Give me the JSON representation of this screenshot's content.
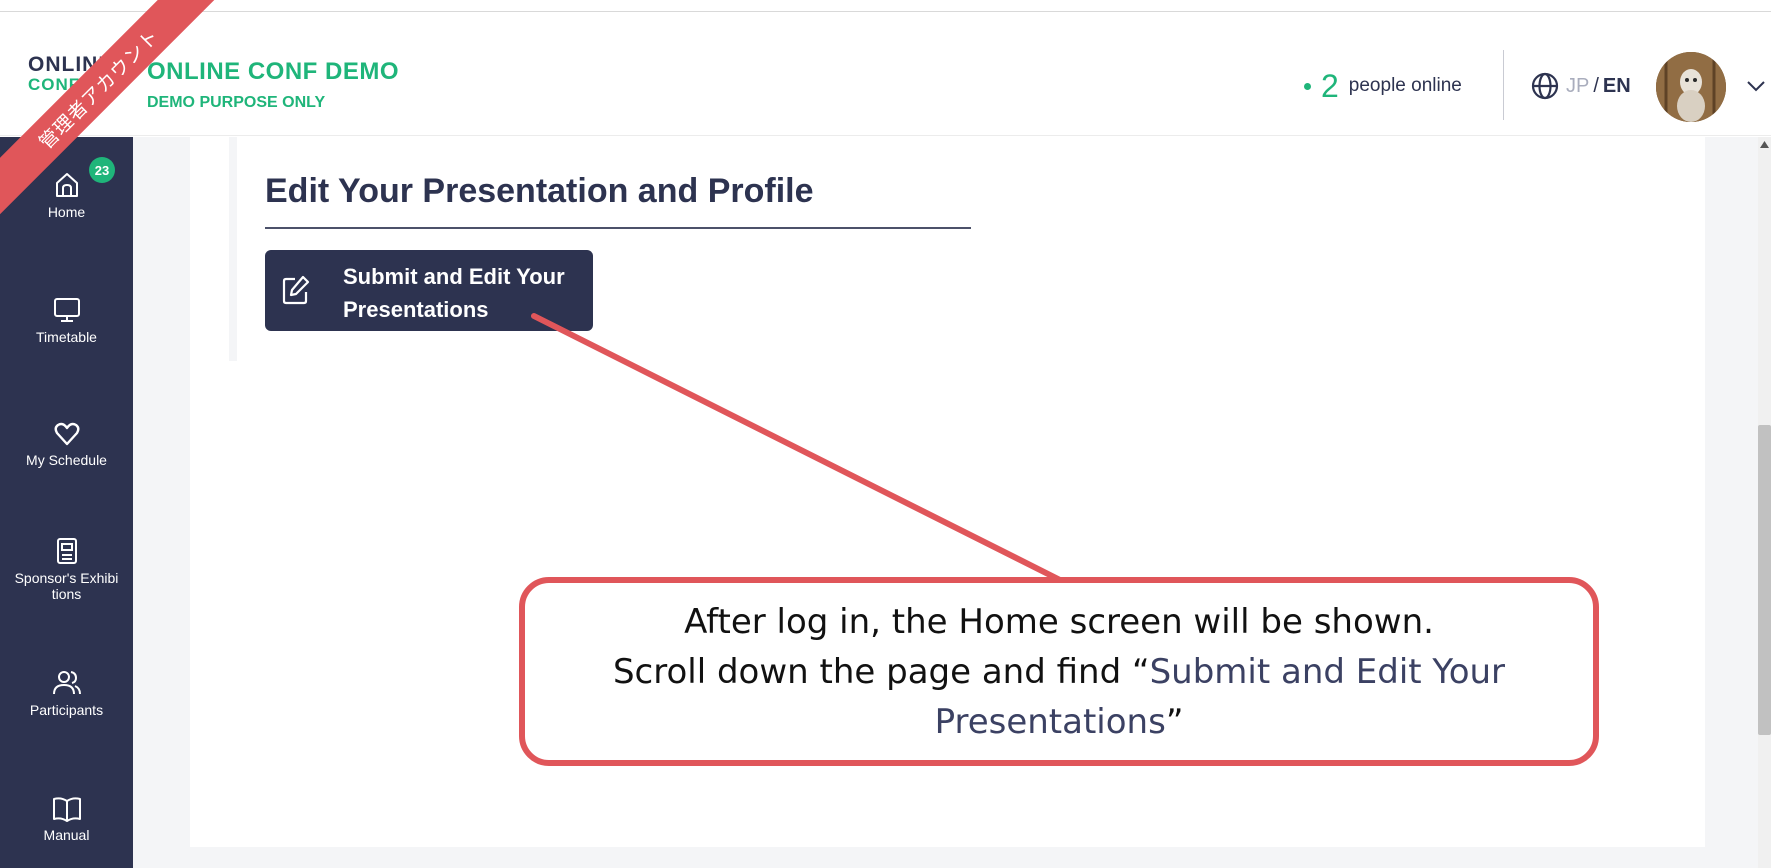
{
  "header": {
    "logo_line1": "ONLINE",
    "logo_line2": "CONF",
    "app_title": "ONLINE CONF DEMO",
    "app_subtitle": "DEMO PURPOSE ONLY",
    "online_count": "2",
    "online_label": "people online",
    "lang_jp": "JP",
    "lang_separator": "/",
    "lang_en": "EN",
    "globe_icon": "globe-icon",
    "dropdown_icon": "chevron-down-icon"
  },
  "ribbon": {
    "text": "管理者アカウント"
  },
  "sidebar": {
    "home_badge": "23",
    "items": [
      {
        "label": "Home",
        "icon": "home-icon"
      },
      {
        "label": "Timetable",
        "icon": "monitor-icon"
      },
      {
        "label": "My Schedule",
        "icon": "heart-icon"
      },
      {
        "label": "Sponsor's Exhibitions",
        "label_line1": "Sponsor's Exhibi",
        "label_line2": "tions",
        "icon": "booth-icon"
      },
      {
        "label": "Participants",
        "icon": "people-icon"
      },
      {
        "label": "Manual",
        "icon": "book-icon"
      }
    ]
  },
  "main": {
    "section_title": "Edit Your Presentation and Profile",
    "submit_button": {
      "line1": "Submit and Edit Your",
      "line2": "Presentations",
      "icon": "edit-icon"
    }
  },
  "annotation": {
    "line1": "After log in, the Home screen will be shown.",
    "line2_prefix": "Scroll down the page and find “",
    "line2_highlight": "Submit and Edit Your",
    "line3_highlight": "Presentations",
    "line3_suffix": "”"
  },
  "colors": {
    "brand_green": "#1fb57a",
    "navy": "#2d3350",
    "annotation_red": "#e0565a"
  }
}
